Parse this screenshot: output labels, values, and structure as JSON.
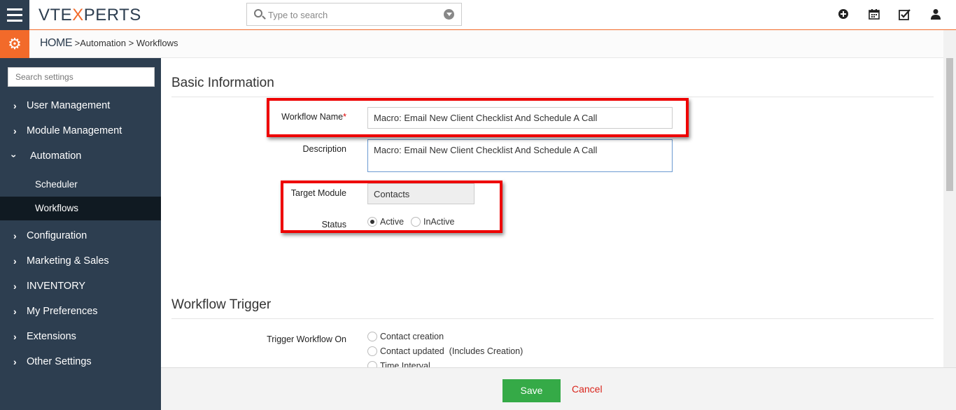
{
  "header": {
    "logo_text": "VTEXPERTS",
    "search_placeholder": "Type to search"
  },
  "breadcrumb": {
    "home": "HOME",
    "sep": ">",
    "automation": "Automation",
    "sep2": ">",
    "workflows": "Workflows"
  },
  "sidebar": {
    "search_placeholder": "Search settings",
    "items": [
      {
        "label": "User Management"
      },
      {
        "label": "Module Management"
      },
      {
        "label": "Automation"
      },
      {
        "label": "Configuration"
      },
      {
        "label": "Marketing & Sales"
      },
      {
        "label": "INVENTORY"
      },
      {
        "label": "My Preferences"
      },
      {
        "label": "Extensions"
      },
      {
        "label": "Other Settings"
      }
    ],
    "subitems": [
      {
        "label": "Scheduler"
      },
      {
        "label": "Workflows"
      }
    ]
  },
  "basic": {
    "title": "Basic Information",
    "workflow_name_label": "Workflow Name",
    "required_mark": "*",
    "workflow_name_value": "Macro: Email New Client Checklist And Schedule A Call",
    "description_label": "Description",
    "description_value": "Macro: Email New Client Checklist And Schedule A Call",
    "target_module_label": "Target Module",
    "target_module_value": "Contacts",
    "status_label": "Status",
    "status_active": "Active",
    "status_inactive": "InActive"
  },
  "trigger": {
    "title": "Workflow Trigger",
    "label": "Trigger Workflow On",
    "options": [
      {
        "label": "Contact creation"
      },
      {
        "label": "Contact updated  (Includes Creation)"
      },
      {
        "label": "Time Interval"
      }
    ]
  },
  "footer": {
    "save_label": "Save",
    "cancel_label": "Cancel"
  },
  "colors": {
    "sidebar_bg": "#2d3e50",
    "accent": "#f26a2a",
    "highlight": "#e00000",
    "save_green": "#35aa47",
    "cancel_red": "#d9251c"
  }
}
